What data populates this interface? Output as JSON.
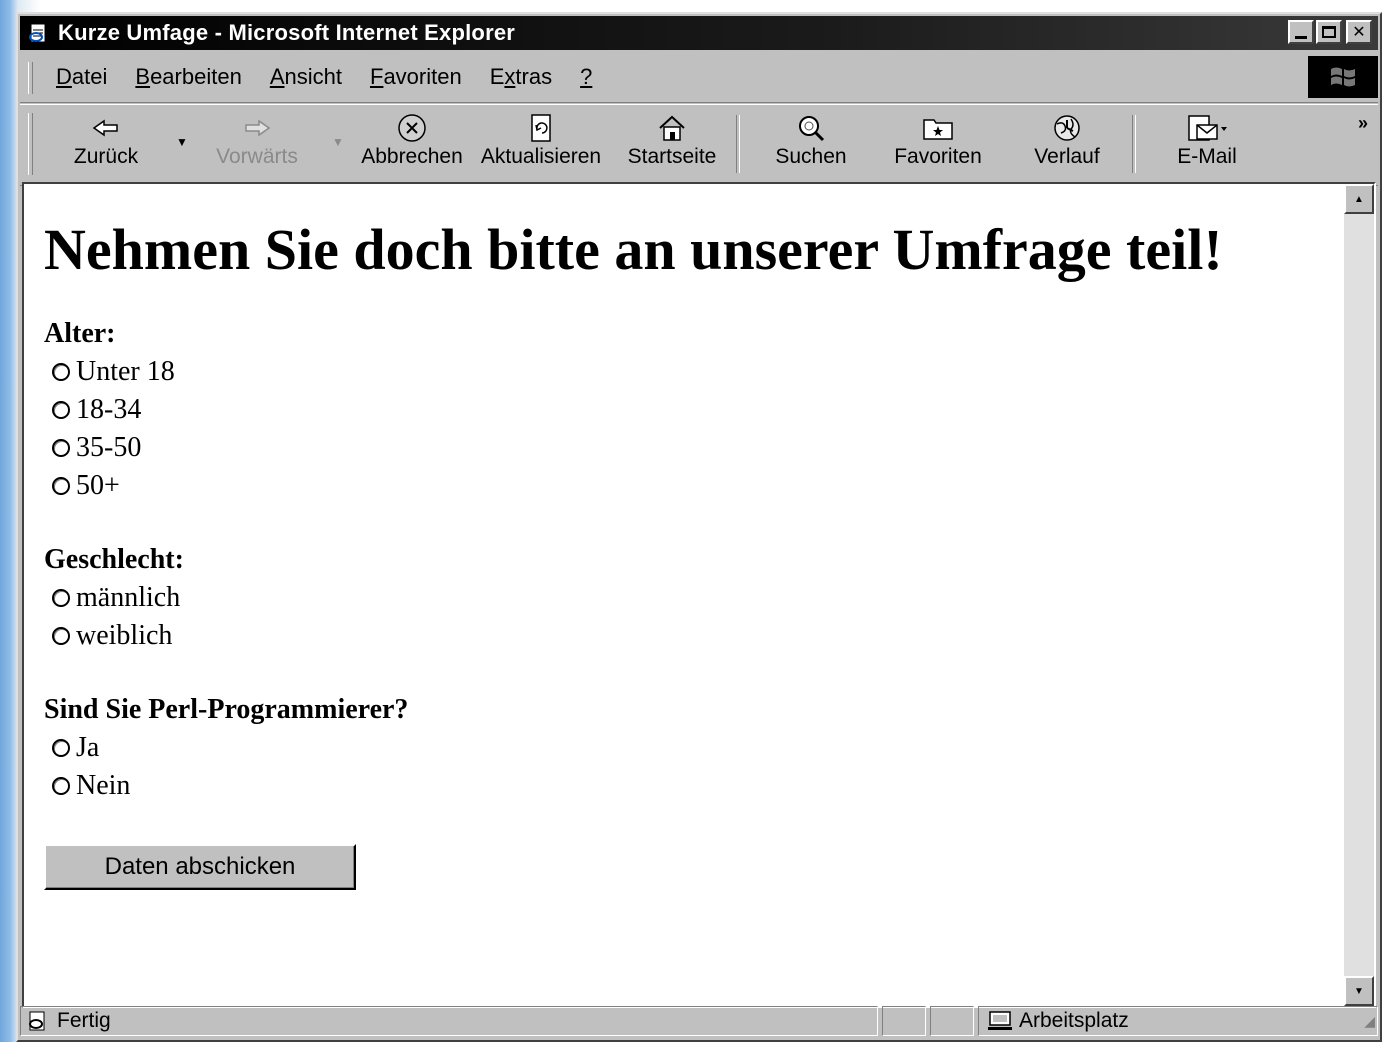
{
  "window": {
    "title": "Kurze Umfage - Microsoft Internet Explorer"
  },
  "menu": {
    "items": [
      {
        "label": "Datei",
        "key": "D",
        "rest": "atei"
      },
      {
        "label": "Bearbeiten",
        "key": "B",
        "rest": "earbeiten"
      },
      {
        "label": "Ansicht",
        "key": "A",
        "rest": "nsicht"
      },
      {
        "label": "Favoriten",
        "key": "F",
        "rest": "avoriten"
      },
      {
        "label": "Extras",
        "pre": "E",
        "key": "x",
        "rest": "tras"
      },
      {
        "label": "?",
        "key": "?",
        "rest": ""
      }
    ]
  },
  "toolbar": {
    "back": "Zurück",
    "forward": "Vorwärts",
    "stop": "Abbrechen",
    "refresh": "Aktualisieren",
    "home": "Startseite",
    "search": "Suchen",
    "favorites": "Favoriten",
    "history": "Verlauf",
    "mail": "E-Mail",
    "more": "»"
  },
  "page": {
    "heading": "Nehmen Sie doch bitte an unserer Umfrage teil!",
    "age": {
      "label": "Alter:",
      "options": [
        "Unter 18",
        "18-34",
        "35-50",
        "50+"
      ]
    },
    "gender": {
      "label": "Geschlecht:",
      "options": [
        "männlich",
        "weiblich"
      ]
    },
    "perl": {
      "label": "Sind Sie Perl-Programmierer?",
      "options": [
        "Ja",
        "Nein"
      ]
    },
    "submit": "Daten abschicken"
  },
  "status": {
    "text": "Fertig",
    "zone": "Arbeitsplatz"
  }
}
